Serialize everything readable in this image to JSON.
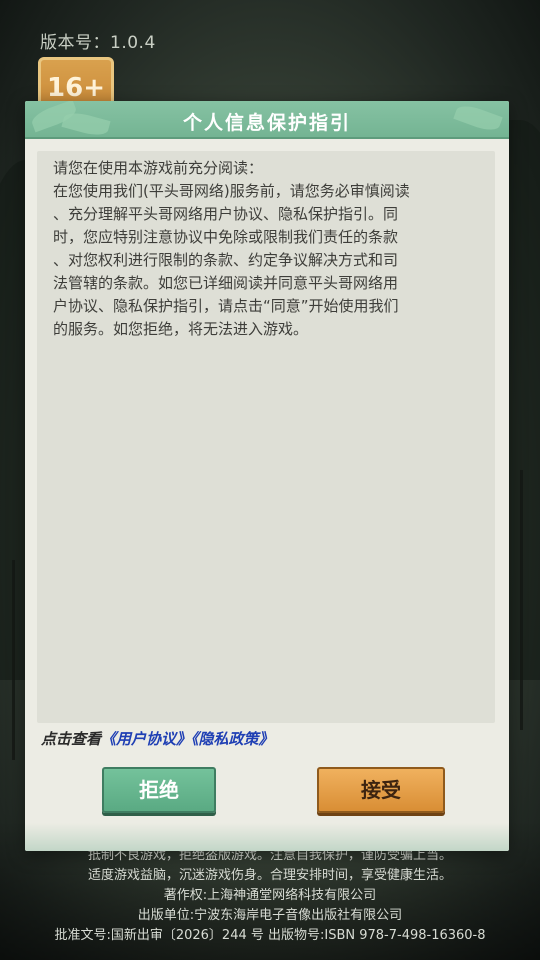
{
  "app": {
    "version_label": "版本号：1.0.4",
    "age_rating": "16+"
  },
  "dialog": {
    "title": "个人信息保护指引",
    "content_lines": [
      "请您在使用本游戏前充分阅读：",
      "在您使用我们(平头哥网络)服务前，请您务必审慎阅读",
      "、充分理解平头哥网络用户协议、隐私保护指引。同",
      "时，您应特别注意协议中免除或限制我们责任的条款",
      "、对您权利进行限制的条款、约定争议解决方式和司",
      "法管辖的条款。如您已详细阅读并同意平头哥网络用",
      "户协议、隐私保护指引，请点击“同意”开始使用我们",
      "的服务。如您拒绝，将无法进入游戏。"
    ],
    "links_prefix": "点击查看",
    "user_agreement_link": "《用户协议》",
    "privacy_policy_link": "《隐私政策》",
    "reject_label": "拒绝",
    "accept_label": "接受"
  },
  "footer": {
    "line1": "抵制不良游戏，拒绝盗版游戏。注意自我保护，谨防受骗上当。",
    "line2": "适度游戏益脑，沉迷游戏伤身。合理安排时间，享受健康生活。",
    "line3": "著作权:上海神通堂网络科技有限公司",
    "line4": "出版单位:宁波东海岸电子音像出版社有限公司",
    "line5": "批准文号:国新出审〔2026〕244 号  出版物号:ISBN 978-7-498-16360-8"
  },
  "colors": {
    "header_green": "#7cba99",
    "reject_green": "#66b68f",
    "accept_orange": "#e6a049",
    "link_blue": "#1f3fb4"
  }
}
